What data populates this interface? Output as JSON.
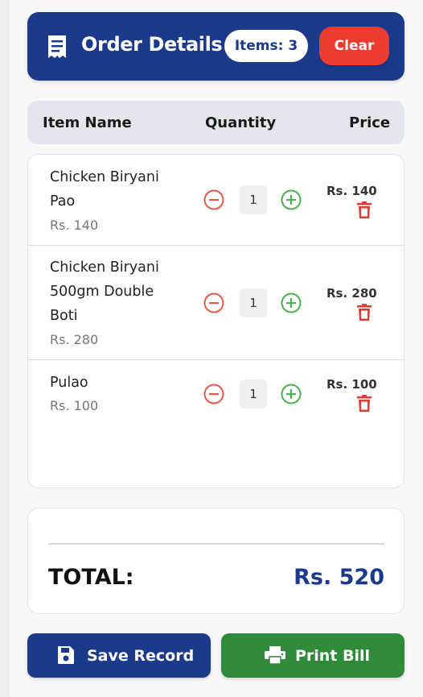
{
  "header": {
    "title": "Order Details",
    "items_badge": "Items: 3",
    "clear_label": "Clear",
    "icon": "receipt-icon",
    "color": "#1c3a8b"
  },
  "columns": {
    "item_name": "Item Name",
    "quantity": "Quantity",
    "price": "Price"
  },
  "items": [
    {
      "name_lines": [
        "Chicken Biryani",
        "Pao"
      ],
      "unit_price": "Rs. 140",
      "quantity": "1",
      "price": "Rs. 140"
    },
    {
      "name_lines": [
        "Chicken Biryani",
        "500gm Double",
        "Boti"
      ],
      "unit_price": "Rs. 280",
      "quantity": "1",
      "price": "Rs. 280"
    },
    {
      "name_lines": [
        "Pulao"
      ],
      "unit_price": "Rs. 100",
      "quantity": "1",
      "price": "Rs. 100"
    }
  ],
  "total": {
    "label": "TOTAL:",
    "value": "Rs. 520"
  },
  "actions": {
    "save_label": "Save Record",
    "print_label": "Print Bill"
  },
  "colors": {
    "accent": "#1c3a8b",
    "danger": "#ef3c33",
    "success": "#2f8a3a",
    "minus_icon": "#e05a4e",
    "plus_icon": "#4caf50"
  }
}
